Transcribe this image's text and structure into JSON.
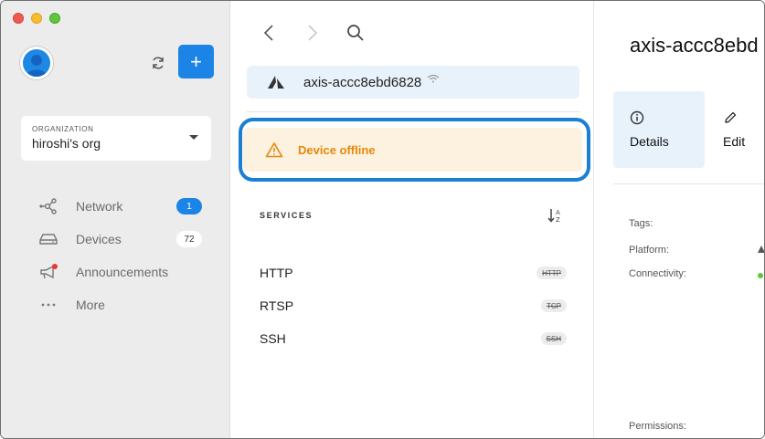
{
  "sidebar": {
    "organization": {
      "label": "ORGANIZATION",
      "value": "hiroshi's org"
    },
    "add_label": "+",
    "nav": [
      {
        "label": "Network",
        "badge": "1",
        "icon": "network-icon"
      },
      {
        "label": "Devices",
        "badge": "72",
        "icon": "devices-icon"
      },
      {
        "label": "Announcements",
        "icon": "megaphone-icon"
      },
      {
        "label": "More",
        "icon": "more-icon"
      }
    ]
  },
  "middle": {
    "device_name": "axis-accc8ebd6828",
    "offline_text": "Device offline",
    "services_title": "SERVICES",
    "services": [
      {
        "name": "HTTP",
        "tag": "HTTP"
      },
      {
        "name": "RTSP",
        "tag": "TCP"
      },
      {
        "name": "SSH",
        "tag": "SSH"
      }
    ]
  },
  "right": {
    "title": "axis-accc8ebd",
    "tabs": [
      {
        "label": "Details"
      },
      {
        "label": "Edit"
      }
    ],
    "props": {
      "tags": "Tags:",
      "platform": "Platform:",
      "connectivity": "Connectivity:",
      "permissions": "Permissions:"
    }
  },
  "colors": {
    "accent": "#1b84e6",
    "offline_text": "#e3890b",
    "offline_bg": "#fdf1df",
    "highlight_ring": "#1b7fd4",
    "device_bar_bg": "#e8f2fb",
    "online_dot": "#5fc53b",
    "announcement_dot": "#e53935"
  }
}
